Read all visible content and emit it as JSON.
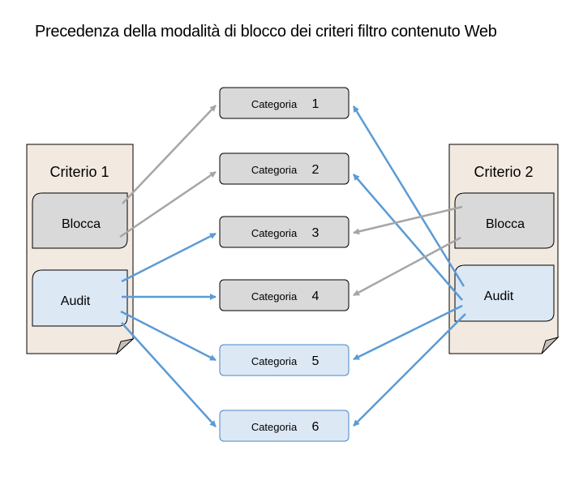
{
  "title": "Precedenza della modalità di blocco dei criteri filtro contenuto Web",
  "colors": {
    "page_fill": "#f2e9e1",
    "block_fill": "#d9d9d9",
    "audit_fill": "#dde8f5",
    "audit_border": "#4a86c5",
    "gray_arrow": "#a6a6a6",
    "blue_arrow": "#5b9bd5"
  },
  "policies": [
    {
      "id": "p1",
      "label": "Criterio 1",
      "block_label": "Blocca",
      "audit_label": "Audit"
    },
    {
      "id": "p2",
      "label": "Criterio 2",
      "block_label": "Blocca",
      "audit_label": "Audit"
    }
  ],
  "categories": [
    {
      "label": "Categoria",
      "number": "1",
      "mode": "block"
    },
    {
      "label": "Categoria",
      "number": "2",
      "mode": "block"
    },
    {
      "label": "Categoria",
      "number": "3",
      "mode": "block"
    },
    {
      "label": "Categoria",
      "number": "4",
      "mode": "block"
    },
    {
      "label": "Categoria",
      "number": "5",
      "mode": "audit"
    },
    {
      "label": "Categoria",
      "number": "6",
      "mode": "audit"
    }
  ],
  "connections": [
    {
      "from": "p1-block",
      "to": 1,
      "color": "gray"
    },
    {
      "from": "p1-block",
      "to": 2,
      "color": "gray"
    },
    {
      "from": "p1-audit",
      "to": 3,
      "color": "blue"
    },
    {
      "from": "p1-audit",
      "to": 4,
      "color": "blue"
    },
    {
      "from": "p1-audit",
      "to": 5,
      "color": "blue"
    },
    {
      "from": "p1-audit",
      "to": 6,
      "color": "blue"
    },
    {
      "from": "p2-audit",
      "to": 1,
      "color": "blue"
    },
    {
      "from": "p2-audit",
      "to": 2,
      "color": "blue"
    },
    {
      "from": "p2-block",
      "to": 3,
      "color": "gray"
    },
    {
      "from": "p2-block",
      "to": 4,
      "color": "gray"
    },
    {
      "from": "p2-audit",
      "to": 5,
      "color": "blue"
    },
    {
      "from": "p2-audit",
      "to": 6,
      "color": "blue"
    }
  ]
}
